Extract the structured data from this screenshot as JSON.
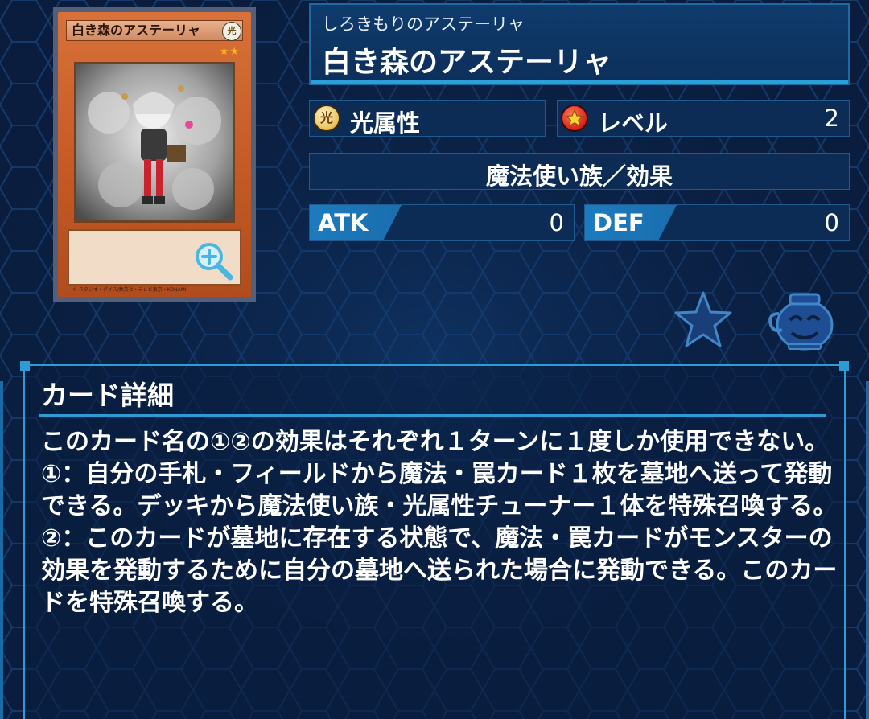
{
  "card": {
    "reading": "しろきもりのアステーリャ",
    "name": "白き森のアステーリャ",
    "image_name_text": "白き森のアステーリャ",
    "image_attr_glyph": "光",
    "image_level_stars": "★★",
    "image_footer_text": "© スタジオ・ダイス/集英社・テレビ東京・KONAMI"
  },
  "stats": {
    "attribute_icon_glyph": "光",
    "attribute": "光属性",
    "level_label": "レベル",
    "level_value": "2",
    "type": "魔法使い族／効果",
    "atk_label": "ATK",
    "atk_value": "0",
    "def_label": "DEF",
    "def_value": "0"
  },
  "icons": {
    "zoom": "zoom-in-icon",
    "favorite": "star-icon",
    "deck": "pot-icon",
    "attribute": "light-attribute-icon",
    "level": "level-star-icon"
  },
  "detail": {
    "title": "カード詳細",
    "text": "このカード名の①②の効果はそれぞれ１ターンに１度しか使用できない。\n①：自分の手札・フィールドから魔法・罠カード１枚を墓地へ送って発動できる。デッキから魔法使い族・光属性チューナー１体を特殊召喚する。\n②：このカードが墓地に存在する状態で、魔法・罠カードがモンスターの効果を発動するために自分の墓地へ送られた場合に発動できる。このカードを特殊召喚する。"
  },
  "colors": {
    "background": "#0a1d3e",
    "panel": "#0c2c55",
    "accent": "#2c9bd6",
    "card_frame": "#c45a26"
  }
}
